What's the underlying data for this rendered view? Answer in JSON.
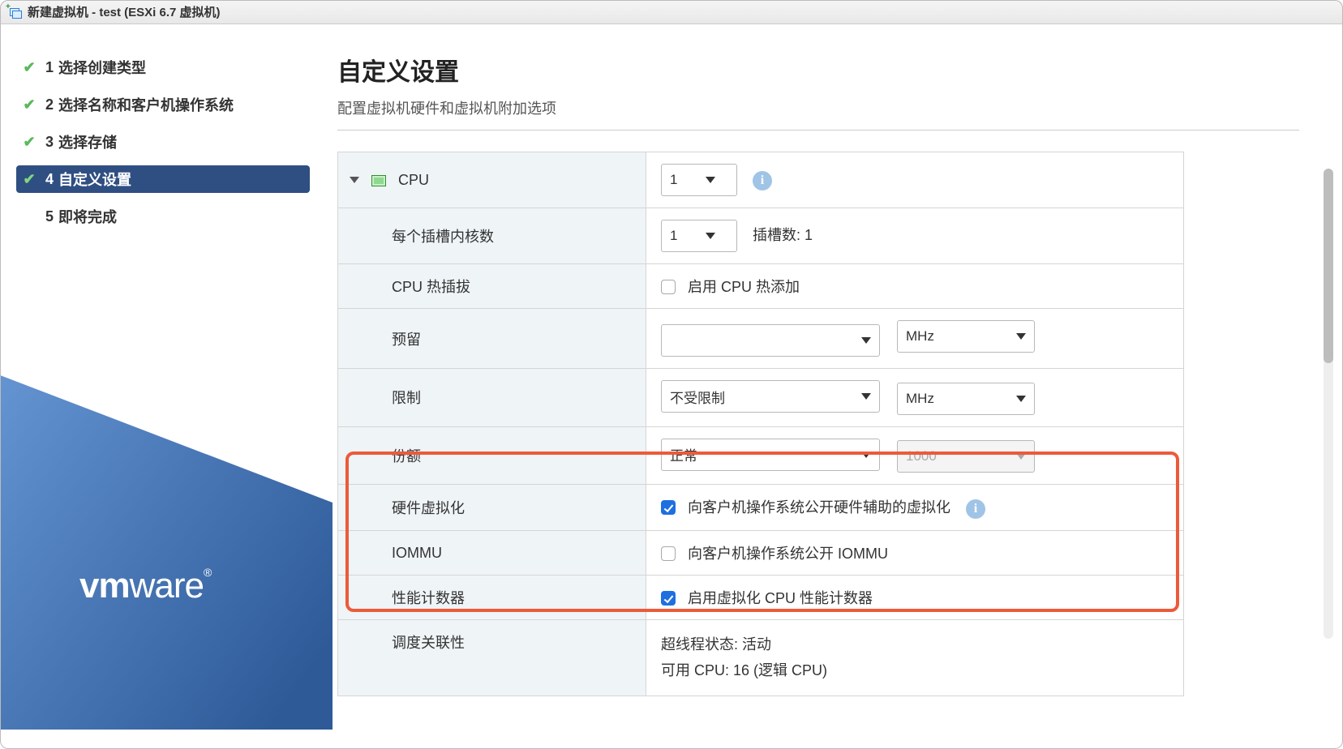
{
  "window": {
    "title": "新建虚拟机 - test (ESXi 6.7 虚拟机)"
  },
  "steps": {
    "s1": "选择创建类型",
    "s2": "选择名称和客户机操作系统",
    "s3": "选择存储",
    "s4": "自定义设置",
    "s5": "即将完成"
  },
  "page": {
    "title": "自定义设置",
    "subtitle": "配置虚拟机硬件和虚拟机附加选项"
  },
  "cpu": {
    "section_label": "CPU",
    "count": "1",
    "cores_label": "每个插槽内核数",
    "cores_value": "1",
    "sockets_text": "插槽数: 1",
    "hotplug_label": "CPU 热插拔",
    "hotplug_checkbox": "启用 CPU 热添加",
    "reserve_label": "预留",
    "reserve_unit": "MHz",
    "limit_label": "限制",
    "limit_value": "不受限制",
    "limit_unit": "MHz",
    "shares_label": "份额",
    "shares_value": "正常",
    "shares_number": "1000",
    "hwvirt_label": "硬件虚拟化",
    "hwvirt_checkbox": "向客户机操作系统公开硬件辅助的虚拟化",
    "iommu_label": "IOMMU",
    "iommu_checkbox": "向客户机操作系统公开 IOMMU",
    "perfcnt_label": "性能计数器",
    "perfcnt_checkbox": "启用虚拟化 CPU 性能计数器",
    "affinity_label": "调度关联性",
    "ht_status": "超线程状态: 活动",
    "avail_cpu": "可用 CPU: 16 (逻辑 CPU)"
  },
  "logo": {
    "brand": "vm",
    "rest": "ware",
    "reg": "®"
  }
}
